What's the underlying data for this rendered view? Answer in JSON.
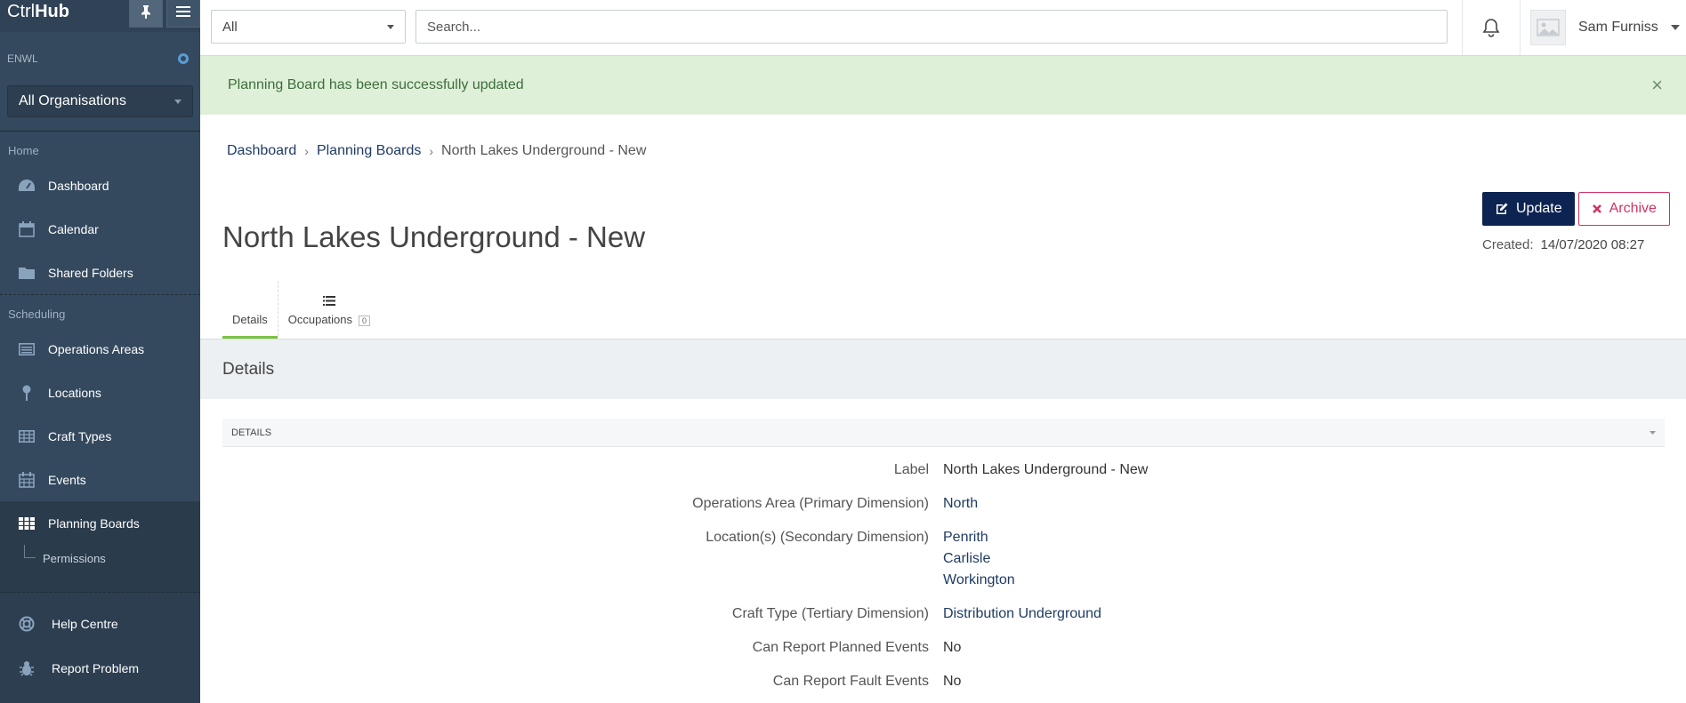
{
  "sidebar": {
    "brand_ctrl": "Ctrl",
    "brand_hub": "Hub",
    "org_code": "ENWL",
    "org_select": "All Organisations",
    "home_label": "Home",
    "home_items": [
      {
        "label": "Dashboard",
        "icon": "dashboard-icon"
      },
      {
        "label": "Calendar",
        "icon": "calendar-icon"
      },
      {
        "label": "Shared Folders",
        "icon": "folder-icon"
      }
    ],
    "scheduling_label": "Scheduling",
    "scheduling_items": [
      {
        "label": "Operations Areas",
        "icon": "list-panel-icon"
      },
      {
        "label": "Locations",
        "icon": "map-pin-icon"
      },
      {
        "label": "Craft Types",
        "icon": "table-icon"
      },
      {
        "label": "Events",
        "icon": "calendar-icon"
      },
      {
        "label": "Planning Boards",
        "icon": "grid-icon"
      }
    ],
    "sub_item": "Permissions",
    "help": "Help Centre",
    "report": "Report Problem"
  },
  "topbar": {
    "scope": "All",
    "search_placeholder": "Search...",
    "user_name": "Sam Furniss"
  },
  "alert": {
    "message": "Planning Board has been successfully updated"
  },
  "breadcrumb": {
    "items": [
      "Dashboard",
      "Planning Boards"
    ],
    "current": "North Lakes Underground - New"
  },
  "page": {
    "title": "North Lakes Underground - New",
    "update_label": "Update",
    "archive_label": "Archive",
    "created_label": "Created:",
    "created_value": "14/07/2020 08:27"
  },
  "tabs": {
    "details": "Details",
    "occupations": "Occupations",
    "occupations_count": "0"
  },
  "details": {
    "section_title": "Details",
    "panel_title": "DETAILS",
    "fields": [
      {
        "label": "Label",
        "values": [
          "North Lakes Underground - New"
        ],
        "link": false
      },
      {
        "label": "Operations Area (Primary Dimension)",
        "values": [
          "North"
        ],
        "link": true
      },
      {
        "label": "Location(s) (Secondary Dimension)",
        "values": [
          "Penrith",
          "Carlisle",
          "Workington"
        ],
        "link": true
      },
      {
        "label": "Craft Type (Tertiary Dimension)",
        "values": [
          "Distribution Underground"
        ],
        "link": true
      },
      {
        "label": "Can Report Planned Events",
        "values": [
          "No"
        ],
        "link": false
      },
      {
        "label": "Can Report Fault Events",
        "values": [
          "No"
        ],
        "link": false
      }
    ]
  },
  "colors": {
    "sidebar_bg": "#34495e",
    "primary_button": "#0d2352",
    "archive": "#d23264",
    "success_bg": "#dff0d8",
    "tab_active": "#7cc242"
  }
}
